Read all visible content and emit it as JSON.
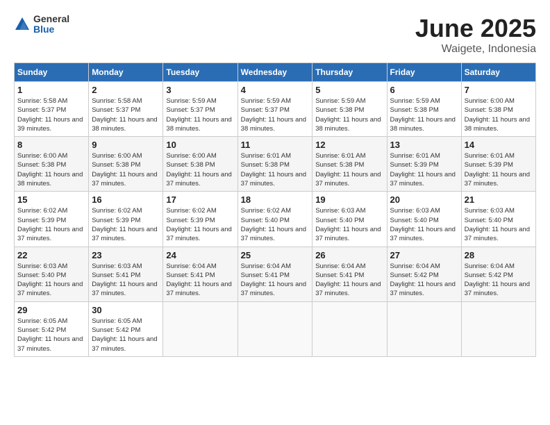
{
  "logo": {
    "general": "General",
    "blue": "Blue"
  },
  "header": {
    "month_year": "June 2025",
    "location": "Waigete, Indonesia"
  },
  "weekdays": [
    "Sunday",
    "Monday",
    "Tuesday",
    "Wednesday",
    "Thursday",
    "Friday",
    "Saturday"
  ],
  "weeks": [
    [
      {
        "day": "1",
        "sunrise": "5:58 AM",
        "sunset": "5:37 PM",
        "daylight": "11 hours and 39 minutes."
      },
      {
        "day": "2",
        "sunrise": "5:58 AM",
        "sunset": "5:37 PM",
        "daylight": "11 hours and 38 minutes."
      },
      {
        "day": "3",
        "sunrise": "5:59 AM",
        "sunset": "5:37 PM",
        "daylight": "11 hours and 38 minutes."
      },
      {
        "day": "4",
        "sunrise": "5:59 AM",
        "sunset": "5:37 PM",
        "daylight": "11 hours and 38 minutes."
      },
      {
        "day": "5",
        "sunrise": "5:59 AM",
        "sunset": "5:38 PM",
        "daylight": "11 hours and 38 minutes."
      },
      {
        "day": "6",
        "sunrise": "5:59 AM",
        "sunset": "5:38 PM",
        "daylight": "11 hours and 38 minutes."
      },
      {
        "day": "7",
        "sunrise": "6:00 AM",
        "sunset": "5:38 PM",
        "daylight": "11 hours and 38 minutes."
      }
    ],
    [
      {
        "day": "8",
        "sunrise": "6:00 AM",
        "sunset": "5:38 PM",
        "daylight": "11 hours and 38 minutes."
      },
      {
        "day": "9",
        "sunrise": "6:00 AM",
        "sunset": "5:38 PM",
        "daylight": "11 hours and 37 minutes."
      },
      {
        "day": "10",
        "sunrise": "6:00 AM",
        "sunset": "5:38 PM",
        "daylight": "11 hours and 37 minutes."
      },
      {
        "day": "11",
        "sunrise": "6:01 AM",
        "sunset": "5:38 PM",
        "daylight": "11 hours and 37 minutes."
      },
      {
        "day": "12",
        "sunrise": "6:01 AM",
        "sunset": "5:38 PM",
        "daylight": "11 hours and 37 minutes."
      },
      {
        "day": "13",
        "sunrise": "6:01 AM",
        "sunset": "5:39 PM",
        "daylight": "11 hours and 37 minutes."
      },
      {
        "day": "14",
        "sunrise": "6:01 AM",
        "sunset": "5:39 PM",
        "daylight": "11 hours and 37 minutes."
      }
    ],
    [
      {
        "day": "15",
        "sunrise": "6:02 AM",
        "sunset": "5:39 PM",
        "daylight": "11 hours and 37 minutes."
      },
      {
        "day": "16",
        "sunrise": "6:02 AM",
        "sunset": "5:39 PM",
        "daylight": "11 hours and 37 minutes."
      },
      {
        "day": "17",
        "sunrise": "6:02 AM",
        "sunset": "5:39 PM",
        "daylight": "11 hours and 37 minutes."
      },
      {
        "day": "18",
        "sunrise": "6:02 AM",
        "sunset": "5:40 PM",
        "daylight": "11 hours and 37 minutes."
      },
      {
        "day": "19",
        "sunrise": "6:03 AM",
        "sunset": "5:40 PM",
        "daylight": "11 hours and 37 minutes."
      },
      {
        "day": "20",
        "sunrise": "6:03 AM",
        "sunset": "5:40 PM",
        "daylight": "11 hours and 37 minutes."
      },
      {
        "day": "21",
        "sunrise": "6:03 AM",
        "sunset": "5:40 PM",
        "daylight": "11 hours and 37 minutes."
      }
    ],
    [
      {
        "day": "22",
        "sunrise": "6:03 AM",
        "sunset": "5:40 PM",
        "daylight": "11 hours and 37 minutes."
      },
      {
        "day": "23",
        "sunrise": "6:03 AM",
        "sunset": "5:41 PM",
        "daylight": "11 hours and 37 minutes."
      },
      {
        "day": "24",
        "sunrise": "6:04 AM",
        "sunset": "5:41 PM",
        "daylight": "11 hours and 37 minutes."
      },
      {
        "day": "25",
        "sunrise": "6:04 AM",
        "sunset": "5:41 PM",
        "daylight": "11 hours and 37 minutes."
      },
      {
        "day": "26",
        "sunrise": "6:04 AM",
        "sunset": "5:41 PM",
        "daylight": "11 hours and 37 minutes."
      },
      {
        "day": "27",
        "sunrise": "6:04 AM",
        "sunset": "5:42 PM",
        "daylight": "11 hours and 37 minutes."
      },
      {
        "day": "28",
        "sunrise": "6:04 AM",
        "sunset": "5:42 PM",
        "daylight": "11 hours and 37 minutes."
      }
    ],
    [
      {
        "day": "29",
        "sunrise": "6:05 AM",
        "sunset": "5:42 PM",
        "daylight": "11 hours and 37 minutes."
      },
      {
        "day": "30",
        "sunrise": "6:05 AM",
        "sunset": "5:42 PM",
        "daylight": "11 hours and 37 minutes."
      },
      null,
      null,
      null,
      null,
      null
    ]
  ],
  "labels": {
    "sunrise": "Sunrise: ",
    "sunset": "Sunset: ",
    "daylight": "Daylight: "
  }
}
